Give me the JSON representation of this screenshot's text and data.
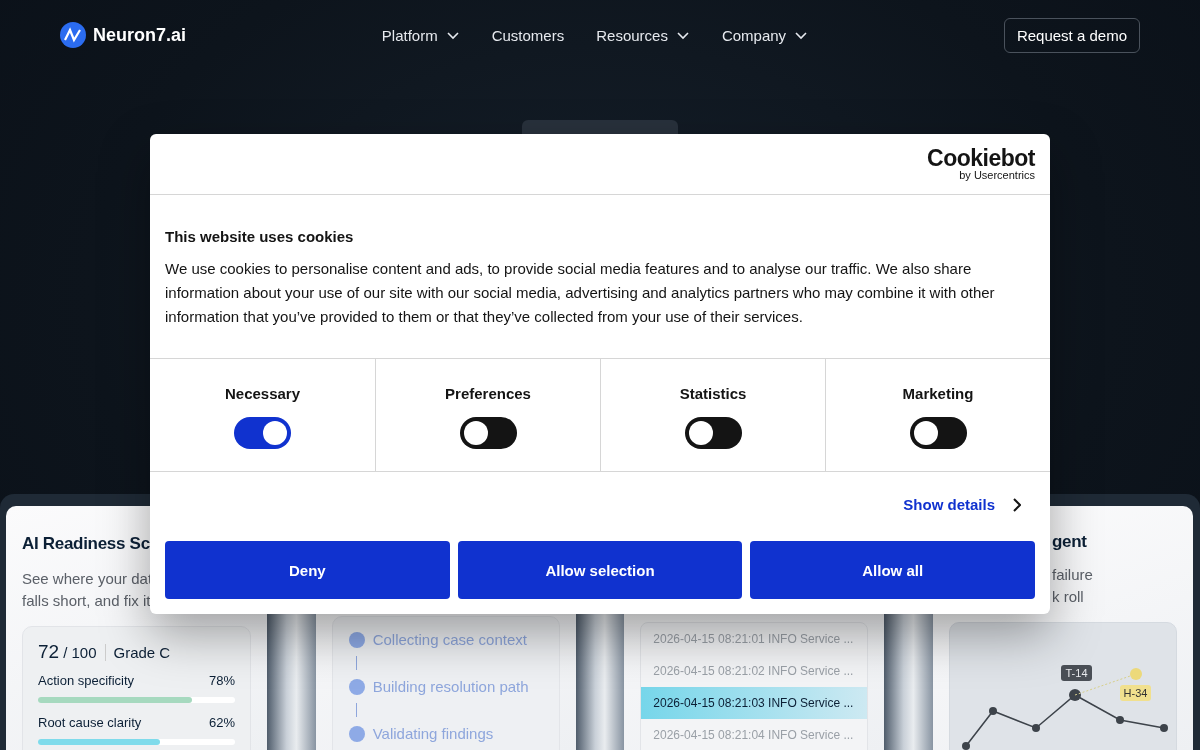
{
  "header": {
    "logo": "Neuron7.ai",
    "nav": [
      {
        "label": "Platform",
        "has_menu": true
      },
      {
        "label": "Customers",
        "has_menu": false
      },
      {
        "label": "Resources",
        "has_menu": true
      },
      {
        "label": "Company",
        "has_menu": true
      }
    ],
    "cta": "Request a demo"
  },
  "cards": [
    {
      "kind": "readiness",
      "title": "AI Readiness Sc",
      "description_lines": [
        "See where your dat",
        "falls short, and fix it"
      ],
      "score": "72",
      "score_max": "/ 100",
      "grade": "Grade C",
      "metrics": [
        {
          "label": "Action specificity",
          "value": "78%",
          "level": 0.78,
          "color": "#a6d9bf"
        },
        {
          "label": "Root cause clarity",
          "value": "62%",
          "level": 0.62,
          "color": "#7fdbeb"
        }
      ]
    },
    {
      "kind": "steps",
      "steps": [
        "Collecting case context",
        "Building resolution path",
        "Validating findings"
      ]
    },
    {
      "kind": "log",
      "rows": [
        {
          "text": "2026-04-15 08:21:01 INFO Service ...",
          "selected": false
        },
        {
          "text": "2026-04-15 08:21:02 INFO Service ...",
          "selected": false
        },
        {
          "text": "2026-04-15 08:21:03 INFO Service ...",
          "selected": true
        },
        {
          "text": "2026-04-15 08:21:04 INFO Service ...",
          "selected": false
        }
      ]
    },
    {
      "kind": "chart",
      "title": "gent",
      "description_lines": [
        "failure",
        "k roll"
      ],
      "tags": [
        {
          "label": "T-14",
          "color": "#4a4f56"
        },
        {
          "label": "H-34",
          "color": "#f1e08e"
        }
      ]
    }
  ],
  "cookie_dialog": {
    "brand": "Cookiebot",
    "brand_sub": "by Usercentrics",
    "title": "This website uses cookies",
    "text": "We use cookies to personalise content and ads, to provide social media features and to analyse our traffic. We also share information about your use of our site with our social media, advertising and analytics partners who may combine it with other information that you’ve provided to them or that they’ve collected from your use of their services.",
    "categories": [
      {
        "label": "Necessary",
        "checked": true
      },
      {
        "label": "Preferences",
        "checked": false
      },
      {
        "label": "Statistics",
        "checked": false
      },
      {
        "label": "Marketing",
        "checked": false
      }
    ],
    "details_link": "Show details",
    "buttons": [
      "Deny",
      "Allow selection",
      "Allow all"
    ]
  }
}
